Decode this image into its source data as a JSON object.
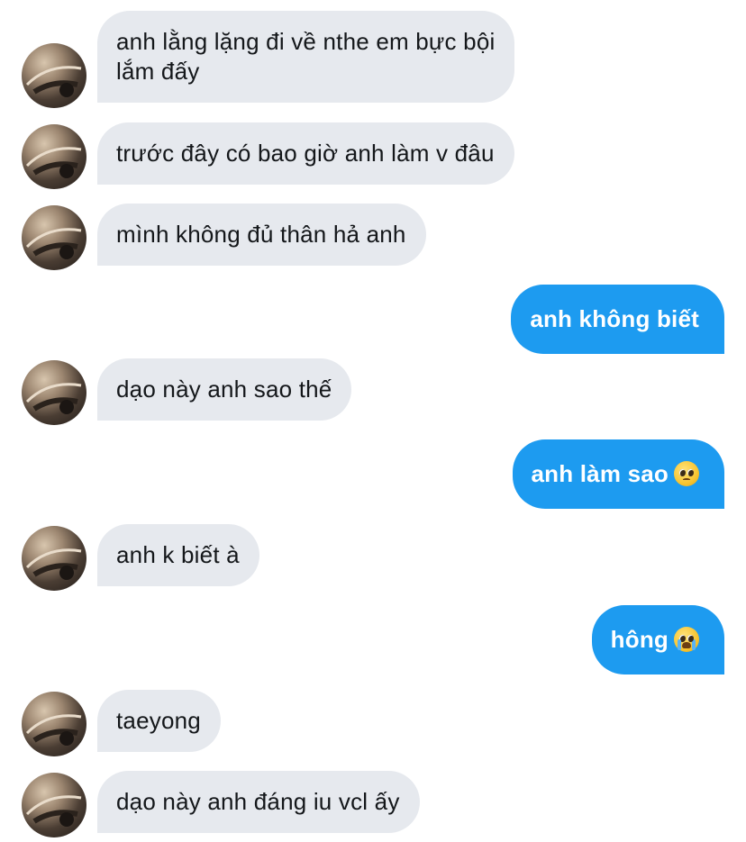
{
  "messages": [
    {
      "side": "in",
      "text": "anh lằng lặng đi về nthe em bực bội",
      "text2": "lắm đấy",
      "avatar_icon": "contact-avatar"
    },
    {
      "side": "in",
      "text": "trước đây có bao giờ anh làm v đâu",
      "avatar_icon": "contact-avatar"
    },
    {
      "side": "in",
      "text": "mình không đủ thân hả anh",
      "avatar_icon": "contact-avatar"
    },
    {
      "side": "out",
      "text": "anh không biết"
    },
    {
      "side": "in",
      "text": "dạo này anh sao thế",
      "avatar_icon": "contact-avatar"
    },
    {
      "side": "out",
      "text": "anh làm sao",
      "emoji": "pleading-face"
    },
    {
      "side": "in",
      "text": "anh k biết à",
      "avatar_icon": "contact-avatar"
    },
    {
      "side": "out",
      "text": "hông",
      "emoji": "loudly-crying-face"
    },
    {
      "side": "in",
      "text": "taeyong",
      "avatar_icon": "contact-avatar"
    },
    {
      "side": "in",
      "text": "dạo này anh đáng iu vcl ấy",
      "avatar_icon": "contact-avatar"
    }
  ],
  "colors": {
    "incoming_bubble": "#e6e9ee",
    "outgoing_bubble": "#1d9bf0",
    "incoming_text": "#14171a",
    "outgoing_text": "#ffffff"
  }
}
